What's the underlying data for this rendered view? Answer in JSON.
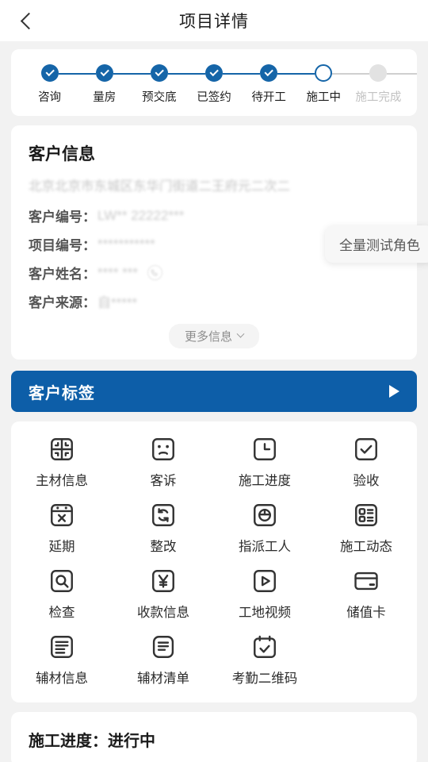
{
  "header": {
    "title": "项目详情",
    "back_icon": "chevron-left-icon"
  },
  "steps": [
    {
      "label": "咨询",
      "state": "done"
    },
    {
      "label": "量房",
      "state": "done"
    },
    {
      "label": "预交底",
      "state": "done"
    },
    {
      "label": "已签约",
      "state": "done"
    },
    {
      "label": "待开工",
      "state": "done"
    },
    {
      "label": "施工中",
      "state": "current"
    },
    {
      "label": "施工完成",
      "state": "todo"
    }
  ],
  "customer_info": {
    "title": "客户信息",
    "address": "北京北京市东城区东华门街道二王府元二次二",
    "fields": [
      {
        "label": "客户编号：",
        "value": "LW** 22222***"
      },
      {
        "label": "项目编号：",
        "value": "***********"
      },
      {
        "label": "客户姓名：",
        "value": "**** ***"
      },
      {
        "label": "客户来源：",
        "value": "自*****"
      }
    ],
    "phone_icon": "phone-icon",
    "more_label": "更多信息",
    "more_icon": "chevron-down-icon"
  },
  "role_pill": {
    "label": "全量测试角色"
  },
  "tag_banner": {
    "title": "客户标签",
    "arrow_icon": "triangle-right-icon",
    "color": "#0d5ea8"
  },
  "menu": [
    {
      "label": "主材信息",
      "icon": "grid-four-panel-icon"
    },
    {
      "label": "客诉",
      "icon": "sad-face-icon"
    },
    {
      "label": "施工进度",
      "icon": "clock-icon"
    },
    {
      "label": "验收",
      "icon": "check-square-icon"
    },
    {
      "label": "延期",
      "icon": "calendar-x-icon"
    },
    {
      "label": "整改",
      "icon": "refresh-loop-icon"
    },
    {
      "label": "指派工人",
      "icon": "worker-helmet-icon"
    },
    {
      "label": "施工动态",
      "icon": "list-detail-icon"
    },
    {
      "label": "检查",
      "icon": "search-square-icon"
    },
    {
      "label": "收款信息",
      "icon": "yen-square-icon"
    },
    {
      "label": "工地视频",
      "icon": "play-square-icon"
    },
    {
      "label": "储值卡",
      "icon": "credit-card-icon"
    },
    {
      "label": "辅材信息",
      "icon": "document-lines-icon"
    },
    {
      "label": "辅材清单",
      "icon": "document-list-icon"
    },
    {
      "label": "考勤二维码",
      "icon": "calendar-check-icon"
    }
  ],
  "progress_section": {
    "title": "施工进度：进行中"
  },
  "colors": {
    "accent_blue": "#1565a8",
    "banner_blue": "#0d5ea8",
    "page_bg": "#f2f2f2",
    "card_bg": "#ffffff",
    "muted_grey": "#c4c4c4"
  }
}
